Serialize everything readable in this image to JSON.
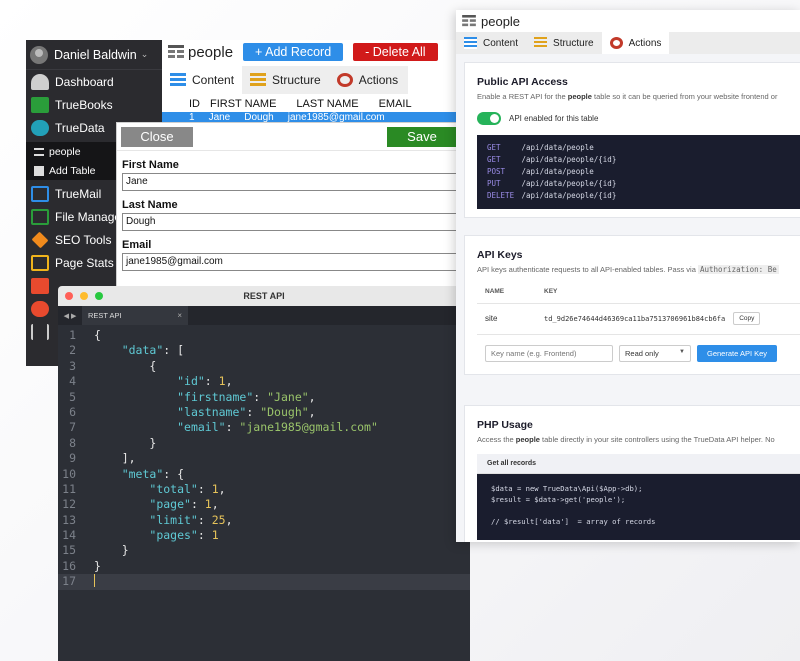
{
  "sidebar": {
    "user": "Daniel Baldwin",
    "user_caret": "⌄",
    "items": [
      {
        "label": "Dashboard",
        "icon": "speedometer-icon",
        "color": "#cfcfcf"
      },
      {
        "label": "TrueBooks",
        "icon": "books-icon",
        "color": "#2a9d3a"
      },
      {
        "label": "TrueData",
        "icon": "database-icon",
        "color": "#22a0b8"
      }
    ],
    "subitems": [
      {
        "label": "people",
        "icon": "table-icon"
      },
      {
        "label": "Add Table",
        "icon": "plus-square-icon"
      }
    ],
    "items2": [
      {
        "label": "TrueMail",
        "icon": "mail-icon",
        "color": "#2e8ee8"
      },
      {
        "label": "File Manage",
        "icon": "file-manager-icon",
        "color": "#2a9d3a"
      },
      {
        "label": "SEO Tools",
        "icon": "diamond-icon",
        "color": "#f08a1c"
      },
      {
        "label": "Page Stats A",
        "icon": "wallet-icon",
        "color": "#f0b41c"
      }
    ]
  },
  "people_panel": {
    "title": "people",
    "add_label": "+ Add Record",
    "delete_label": "- Delete All",
    "tabs": [
      {
        "label": "Content",
        "icon": "table-icon"
      },
      {
        "label": "Structure",
        "icon": "structure-icon"
      },
      {
        "label": "Actions",
        "icon": "gear-icon"
      }
    ],
    "columns": [
      "ID",
      "FIRST NAME",
      "LAST NAME",
      "EMAIL"
    ],
    "row": [
      "1",
      "Jane",
      "Dough",
      "jane1985@gmail.com"
    ]
  },
  "edit_form": {
    "close_label": "Close",
    "save_label": "Save",
    "fields": [
      {
        "label": "First Name",
        "value": "Jane"
      },
      {
        "label": "Last Name",
        "value": "Dough"
      },
      {
        "label": "Email",
        "value": "jane1985@gmail.com"
      }
    ]
  },
  "code_window": {
    "title": "REST API",
    "tab_label": "REST API",
    "tab_close": "×",
    "arrows": "◀ ▶",
    "lines": [
      [
        [
          "p",
          "{"
        ]
      ],
      [
        [
          "p",
          "    "
        ],
        [
          "k",
          "\"data\""
        ],
        [
          "p",
          ": ["
        ]
      ],
      [
        [
          "p",
          "        {"
        ]
      ],
      [
        [
          "p",
          "            "
        ],
        [
          "k",
          "\"id\""
        ],
        [
          "p",
          ": "
        ],
        [
          "n",
          "1"
        ],
        [
          "p",
          ","
        ]
      ],
      [
        [
          "p",
          "            "
        ],
        [
          "k",
          "\"firstname\""
        ],
        [
          "p",
          ": "
        ],
        [
          "s",
          "\"Jane\""
        ],
        [
          "p",
          ","
        ]
      ],
      [
        [
          "p",
          "            "
        ],
        [
          "k",
          "\"lastname\""
        ],
        [
          "p",
          ": "
        ],
        [
          "s",
          "\"Dough\""
        ],
        [
          "p",
          ","
        ]
      ],
      [
        [
          "p",
          "            "
        ],
        [
          "k",
          "\"email\""
        ],
        [
          "p",
          ": "
        ],
        [
          "s",
          "\"jane1985@gmail.com\""
        ]
      ],
      [
        [
          "p",
          "        }"
        ]
      ],
      [
        [
          "p",
          "    ],"
        ]
      ],
      [
        [
          "p",
          "    "
        ],
        [
          "k",
          "\"meta\""
        ],
        [
          "p",
          ": {"
        ]
      ],
      [
        [
          "p",
          "        "
        ],
        [
          "k",
          "\"total\""
        ],
        [
          "p",
          ": "
        ],
        [
          "n",
          "1"
        ],
        [
          "p",
          ","
        ]
      ],
      [
        [
          "p",
          "        "
        ],
        [
          "k",
          "\"page\""
        ],
        [
          "p",
          ": "
        ],
        [
          "n",
          "1"
        ],
        [
          "p",
          ","
        ]
      ],
      [
        [
          "p",
          "        "
        ],
        [
          "k",
          "\"limit\""
        ],
        [
          "p",
          ": "
        ],
        [
          "n",
          "25"
        ],
        [
          "p",
          ","
        ]
      ],
      [
        [
          "p",
          "        "
        ],
        [
          "k",
          "\"pages\""
        ],
        [
          "p",
          ": "
        ],
        [
          "n",
          "1"
        ]
      ],
      [
        [
          "p",
          "    }"
        ]
      ],
      [
        [
          "p",
          "}"
        ]
      ],
      [
        [
          "p",
          ""
        ]
      ]
    ]
  },
  "actions_panel": {
    "title": "people",
    "tabs": [
      {
        "label": "Content",
        "icon": "table-icon"
      },
      {
        "label": "Structure",
        "icon": "structure-icon"
      },
      {
        "label": "Actions",
        "icon": "gear-icon"
      }
    ],
    "public_api": {
      "heading": "Public API Access",
      "desc_pre": "Enable a REST API for the ",
      "desc_bold": "people",
      "desc_post": " table so it can be queried from your website frontend or",
      "toggle_label": "API enabled for this table",
      "endpoints": [
        {
          "method": "GET",
          "path": "/api/data/people"
        },
        {
          "method": "GET",
          "path": "/api/data/people/{id}"
        },
        {
          "method": "POST",
          "path": "/api/data/people"
        },
        {
          "method": "PUT",
          "path": "/api/data/people/{id}"
        },
        {
          "method": "DELETE",
          "path": "/api/data/people/{id}"
        }
      ]
    },
    "api_keys": {
      "heading": "API Keys",
      "desc_pre": "API keys authenticate requests to all API-enabled tables. Pass via ",
      "desc_code": "Authorization: Be",
      "col_name": "NAME",
      "col_key": "KEY",
      "row_name": "site",
      "row_key": "td_9d26e74644d46369ca11ba7513706961b84cb6fa",
      "copy_label": "Copy",
      "name_placeholder": "Key name (e.g. Frontend)",
      "scope_value": "Read only",
      "generate_label": "Generate API Key"
    },
    "php": {
      "heading": "PHP Usage",
      "desc_pre": "Access the ",
      "desc_bold": "people",
      "desc_post": " table directly in your site controllers using the TrueData API helper. No",
      "code_label": "Get all records",
      "lines": [
        "$data = new TrueData\\Api($App->db);",
        "$result = $data->get('people');",
        "",
        "// $result['data']  = array of records"
      ]
    }
  }
}
